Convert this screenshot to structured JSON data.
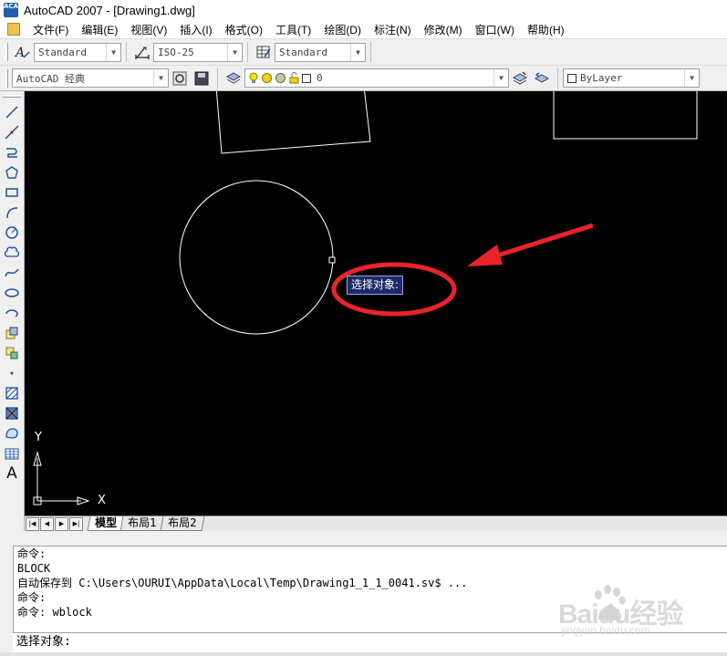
{
  "window": {
    "title": "AutoCAD 2007 - [Drawing1.dwg]"
  },
  "app_logo_text": "ACAD",
  "menu": [
    "文件(F)",
    "编辑(E)",
    "视图(V)",
    "插入(I)",
    "格式(O)",
    "工具(T)",
    "绘图(D)",
    "标注(N)",
    "修改(M)",
    "窗口(W)",
    "帮助(H)"
  ],
  "toolbar_styles": {
    "text_style": "Standard",
    "dim_style": "ISO-25",
    "table_style": "Standard"
  },
  "toolbar_layers": {
    "workspace": "AutoCAD 经典",
    "layer": "0",
    "color": "ByLayer"
  },
  "draw_tools": [
    "line-icon",
    "construction-line-icon",
    "polyline-icon",
    "polygon-icon",
    "rectangle-icon",
    "arc-icon",
    "circle-icon",
    "revision-cloud-icon",
    "spline-icon",
    "ellipse-icon",
    "ellipse-arc-icon",
    "insert-block-icon",
    "make-block-icon",
    "point-icon",
    "hatch-icon",
    "gradient-icon",
    "region-icon",
    "table-icon",
    "multiline-text-icon"
  ],
  "text_tool_glyph": "A",
  "canvas": {
    "prompt_tooltip": "选择对象:",
    "ucs_x_label": "X",
    "ucs_y_label": "Y"
  },
  "layout_tabs": [
    "模型",
    "布局1",
    "布局2"
  ],
  "command_window": {
    "history": [
      "命令:",
      "BLOCK",
      "自动保存到 C:\\Users\\OURUI\\AppData\\Local\\Temp\\Drawing1_1_1_0041.sv$ ...",
      "命令:",
      "命令: wblock"
    ],
    "current_prompt": "选择对象:"
  },
  "watermark": {
    "brand": "Baidu经验",
    "url": "jingyan.baidu.com"
  },
  "colors": {
    "canvas_bg": "#000000",
    "annotation_red": "#e8242a",
    "tooltip_bg": "#1e2a6b"
  }
}
